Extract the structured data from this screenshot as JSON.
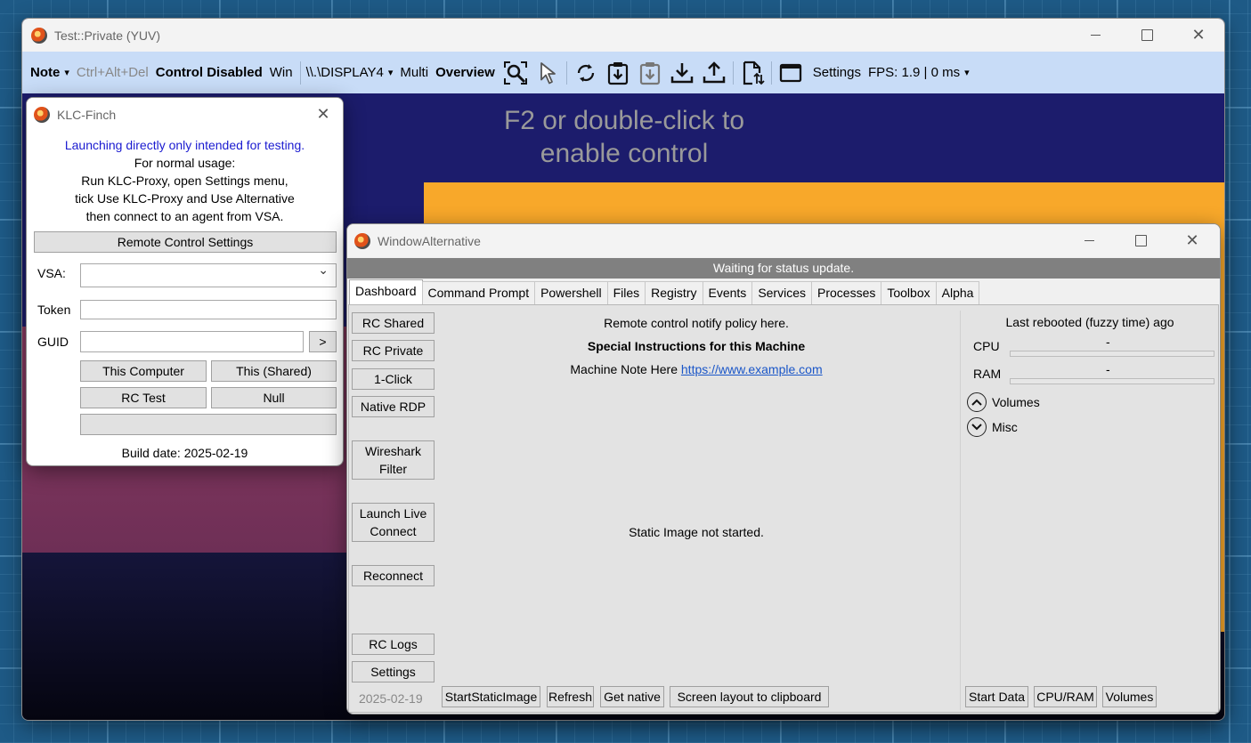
{
  "main_window": {
    "title": "Test::Private (YUV)",
    "toolbar": {
      "note": "Note",
      "ctrl_alt_del": "Ctrl+Alt+Del",
      "control_status": "Control Disabled",
      "win": "Win",
      "display": "\\\\.\\DISPLAY4",
      "multi": "Multi",
      "overview": "Overview",
      "settings": "Settings",
      "fps": "FPS: 1.9 | 0 ms"
    },
    "overlay_message_line1": "F2 or double-click to",
    "overlay_message_line2": "enable control"
  },
  "finch": {
    "title": "KLC-Finch",
    "warning": "Launching directly only intended for testing.",
    "lines": [
      "For normal usage:",
      "Run KLC-Proxy, open Settings menu,",
      "tick Use KLC-Proxy and Use Alternative",
      "then connect to an agent from VSA."
    ],
    "rc_settings_button": "Remote Control Settings",
    "vsa_label": "VSA:",
    "token_label": "Token",
    "guid_label": "GUID",
    "guid_go": ">",
    "this_computer": "This Computer",
    "this_shared": "This (Shared)",
    "rc_test": "RC Test",
    "null": "Null",
    "build_date": "Build date: 2025-02-19"
  },
  "alt": {
    "title": "WindowAlternative",
    "status": "Waiting for status update.",
    "tabs": [
      "Dashboard",
      "Command Prompt",
      "Powershell",
      "Files",
      "Registry",
      "Events",
      "Services",
      "Processes",
      "Toolbox",
      "Alpha"
    ],
    "side_buttons": {
      "rc_shared": "RC Shared",
      "rc_private": "RC Private",
      "one_click": "1-Click",
      "native_rdp": "Native RDP",
      "wireshark_1": "Wireshark",
      "wireshark_2": "Filter",
      "launch_1": "Launch Live",
      "launch_2": "Connect",
      "reconnect": "Reconnect",
      "rc_logs": "RC Logs",
      "settings": "Settings"
    },
    "notify_policy": "Remote control notify policy here.",
    "special_instructions": "Special Instructions for this Machine",
    "machine_note": "Machine Note Here",
    "machine_note_link": "https://www.example.com",
    "static_image_status": "Static Image not started.",
    "date": "2025-02-19",
    "bottom_buttons": {
      "start_static": "StartStaticImage",
      "refresh": "Refresh",
      "get_native": "Get native",
      "screen_layout": "Screen layout to clipboard"
    },
    "right": {
      "last_rebooted": "Last rebooted (fuzzy time) ago",
      "cpu_label": "CPU",
      "cpu_value": "-",
      "cpu_usage": 0,
      "ram_label": "RAM",
      "ram_value": "-",
      "ram_usage": 0,
      "volumes": "Volumes",
      "misc": "Misc",
      "start_data": "Start Data",
      "cpu_ram": "CPU/RAM",
      "volumes_btn": "Volumes"
    }
  },
  "icons": [
    "search-zoom-icon",
    "pointer-icon",
    "sync-icon",
    "clipboard-download-icon",
    "clipboard-disabled-icon",
    "download-icon",
    "upload-icon",
    "file-transfer-icon",
    "window-icon",
    "app-logo-icon"
  ]
}
